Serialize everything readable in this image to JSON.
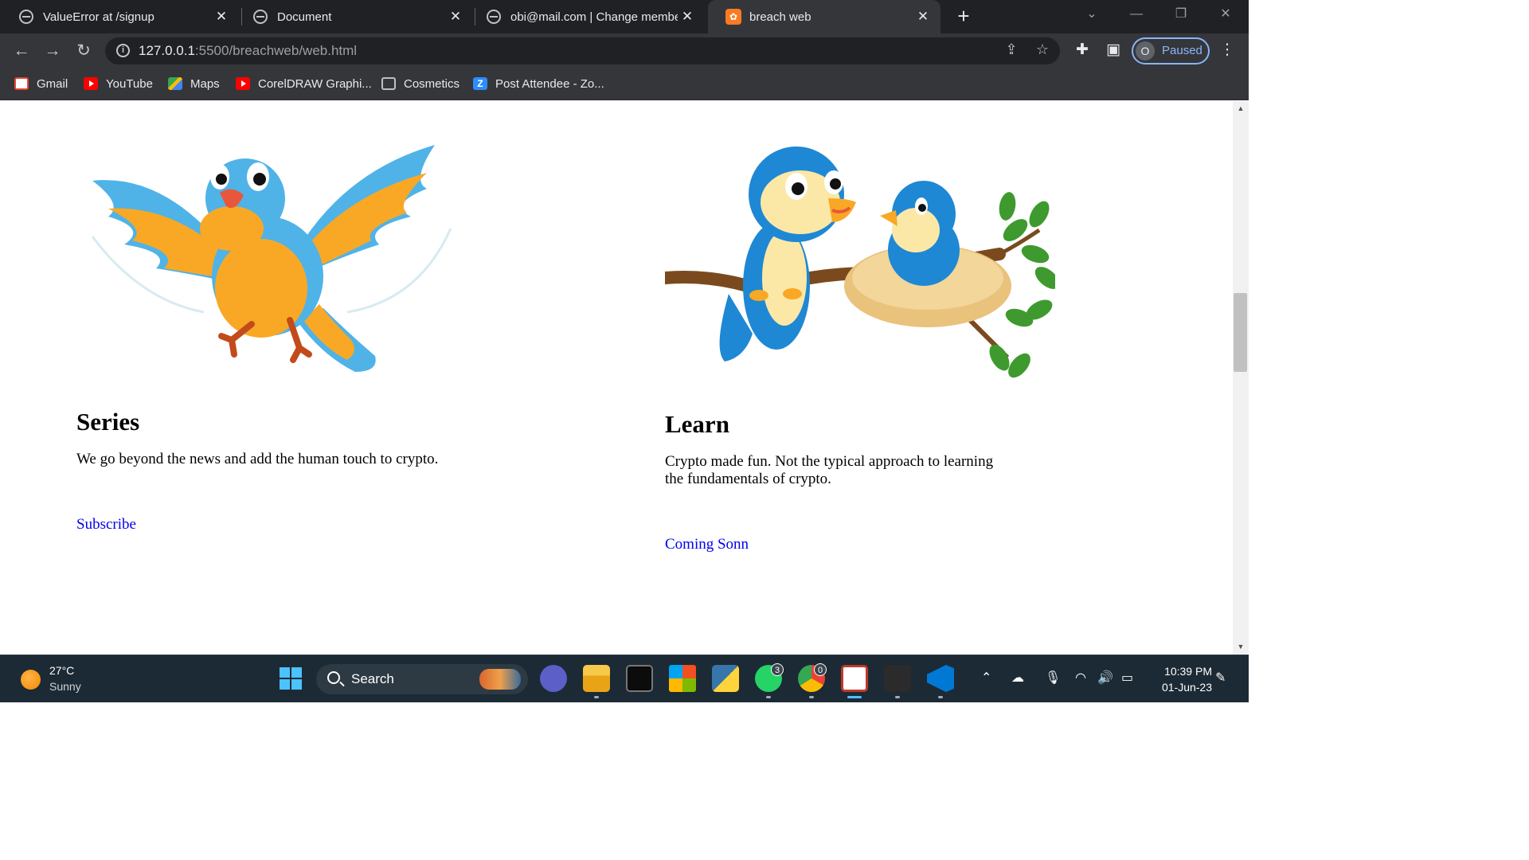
{
  "tabs": [
    {
      "title": "ValueError at /signup",
      "close": "✕"
    },
    {
      "title": "Document",
      "close": "✕"
    },
    {
      "title": "obi@mail.com | Change member",
      "close": "✕"
    },
    {
      "title": "breach web",
      "close": "✕"
    }
  ],
  "new_tab": "+",
  "address": {
    "host": "127.0.0.1",
    "path": ":5500/breachweb/web.html"
  },
  "profile": {
    "initial": "O",
    "status": "Paused"
  },
  "bookmarks": [
    {
      "label": "Gmail",
      "icon": "gmail-icon"
    },
    {
      "label": "YouTube",
      "icon": "youtube-icon"
    },
    {
      "label": "Maps",
      "icon": "maps-icon"
    },
    {
      "label": "CorelDRAW Graphi...",
      "icon": "youtube-icon"
    },
    {
      "label": "Cosmetics",
      "icon": "globe-icon"
    },
    {
      "label": "Post Attendee - Zo...",
      "icon": "zoom-icon"
    }
  ],
  "cards": [
    {
      "heading": "Series",
      "text": "We go beyond the news and add the human touch to crypto.",
      "link": "Subscribe"
    },
    {
      "heading": "Learn",
      "text": "Crypto made fun. Not the typical approach to learning the fundamentals of crypto.",
      "link": "Coming Sonn"
    }
  ],
  "taskbar": {
    "weather": {
      "temp": "27°C",
      "condition": "Sunny"
    },
    "search_label": "Search",
    "whatsapp_badge": "3",
    "chrome_badge": "0",
    "time": "10:39 PM",
    "date": "01-Jun-23"
  },
  "colors": {
    "link": "#0000ee",
    "bird_blue": "#4fb3e8",
    "bird_orange": "#f9a825",
    "profile_accent": "#8ab4f8"
  }
}
